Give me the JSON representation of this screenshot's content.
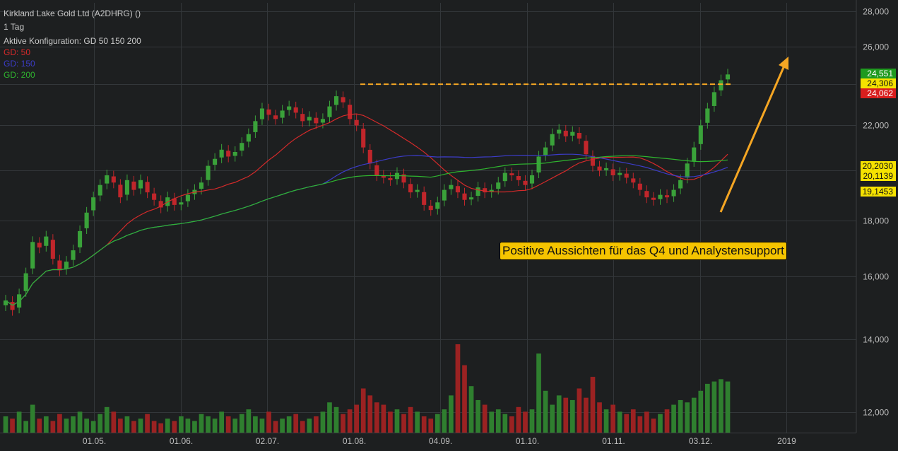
{
  "header": {
    "title": "Kirkland Lake Gold Ltd (A2DHRG) ()",
    "period": "1 Tag",
    "config": "Aktive Konfiguration: GD 50 150 200",
    "legend": [
      {
        "label": "GD: 50",
        "color": "#d42a2a"
      },
      {
        "label": "GD: 150",
        "color": "#3c3cc8"
      },
      {
        "label": "GD: 200",
        "color": "#2fb52f"
      }
    ]
  },
  "annotation": "Positive Aussichten für das Q4 und Analystensupport",
  "colors": {
    "background": "#1d1f20",
    "grid": "#33373a",
    "up": "#3aa23a",
    "down": "#c0262b",
    "annotation": "#f5a623"
  },
  "chart_data": {
    "type": "candlestick",
    "x_ticks": [
      "01.05.",
      "01.06.",
      "02.07.",
      "01.08.",
      "04.09.",
      "01.10.",
      "01.11.",
      "03.12.",
      "2019"
    ],
    "y_ticks": [
      "28,000",
      "26,000",
      "24,000",
      "22,000",
      "20,000",
      "18,000",
      "16,000",
      "14,000",
      "12,000"
    ],
    "ylim": [
      11.5,
      28.5
    ],
    "y_scale": "log",
    "price_labels": [
      {
        "text": "24,551",
        "value": 24.551,
        "bg": "#1f9a1f",
        "fg": "#ffffff"
      },
      {
        "text": "24,306",
        "value": 24.306,
        "bg": "#f5e200",
        "fg": "#111111"
      },
      {
        "text": "24,062",
        "value": 24.062,
        "bg": "#d81e1e",
        "fg": "#ffffff"
      },
      {
        "text": "20,2030",
        "value": 20.203,
        "bg": "#f5e200",
        "fg": "#111111"
      },
      {
        "text": "20,1139",
        "value": 20.1139,
        "bg": "#f5e200",
        "fg": "#111111"
      },
      {
        "text": "19,1453",
        "value": 19.1453,
        "bg": "#f5e200",
        "fg": "#111111"
      }
    ],
    "resistance_level": 24.0,
    "close": [
      15.2,
      14.9,
      15.4,
      16.1,
      17.2,
      17.0,
      17.4,
      16.6,
      16.2,
      16.5,
      16.9,
      17.6,
      18.3,
      18.9,
      19.4,
      19.8,
      19.5,
      18.9,
      19.6,
      19.2,
      19.6,
      19.1,
      18.8,
      18.5,
      18.9,
      18.6,
      18.7,
      19.0,
      19.2,
      19.5,
      20.2,
      20.5,
      20.9,
      20.6,
      20.8,
      21.2,
      21.6,
      22.2,
      22.8,
      22.5,
      22.3,
      22.7,
      22.9,
      22.6,
      22.2,
      22.4,
      22.1,
      22.3,
      22.9,
      23.4,
      23.1,
      22.3,
      22.0,
      21.0,
      20.3,
      19.8,
      19.7,
      19.6,
      19.9,
      19.5,
      19.1,
      19.2,
      18.6,
      18.4,
      18.7,
      19.2,
      19.4,
      19.1,
      18.8,
      18.9,
      19.3,
      19.1,
      19.2,
      19.5,
      19.9,
      19.8,
      19.6,
      19.4,
      19.8,
      20.6,
      21.0,
      21.6,
      21.8,
      21.5,
      21.7,
      21.4,
      20.7,
      20.2,
      20.0,
      20.1,
      19.8,
      19.9,
      19.7,
      19.5,
      19.2,
      18.9,
      18.8,
      19.0,
      18.9,
      19.2,
      19.6,
      20.3,
      21.0,
      22.0,
      22.8,
      23.6,
      24.2,
      24.5
    ],
    "volume_range": [
      0,
      3.8
    ],
    "volume": [
      0.7,
      0.6,
      0.9,
      0.5,
      1.2,
      0.6,
      0.7,
      0.5,
      0.8,
      0.6,
      0.7,
      0.9,
      0.6,
      0.5,
      0.8,
      1.1,
      0.9,
      0.6,
      0.7,
      0.5,
      0.6,
      0.8,
      0.5,
      0.4,
      0.6,
      0.5,
      0.7,
      0.6,
      0.5,
      0.8,
      0.7,
      0.6,
      0.9,
      0.7,
      0.6,
      0.8,
      1.0,
      0.7,
      0.6,
      0.9,
      0.5,
      0.6,
      0.7,
      0.8,
      0.5,
      0.6,
      0.7,
      0.9,
      1.3,
      1.1,
      0.8,
      1.0,
      1.2,
      1.9,
      1.6,
      1.3,
      1.2,
      0.9,
      1.0,
      0.8,
      1.1,
      0.9,
      0.7,
      0.6,
      0.8,
      1.0,
      1.6,
      3.8,
      2.9,
      2.0,
      1.4,
      1.2,
      0.9,
      1.0,
      0.8,
      0.7,
      1.1,
      0.9,
      1.0,
      3.4,
      1.8,
      1.2,
      1.6,
      1.5,
      1.4,
      1.9,
      1.5,
      2.4,
      1.3,
      1.0,
      1.2,
      0.9,
      0.8,
      1.0,
      0.7,
      0.9,
      0.6,
      0.8,
      1.0,
      1.2,
      1.4,
      1.3,
      1.5,
      1.8,
      2.1,
      2.2,
      2.3,
      2.2
    ]
  }
}
